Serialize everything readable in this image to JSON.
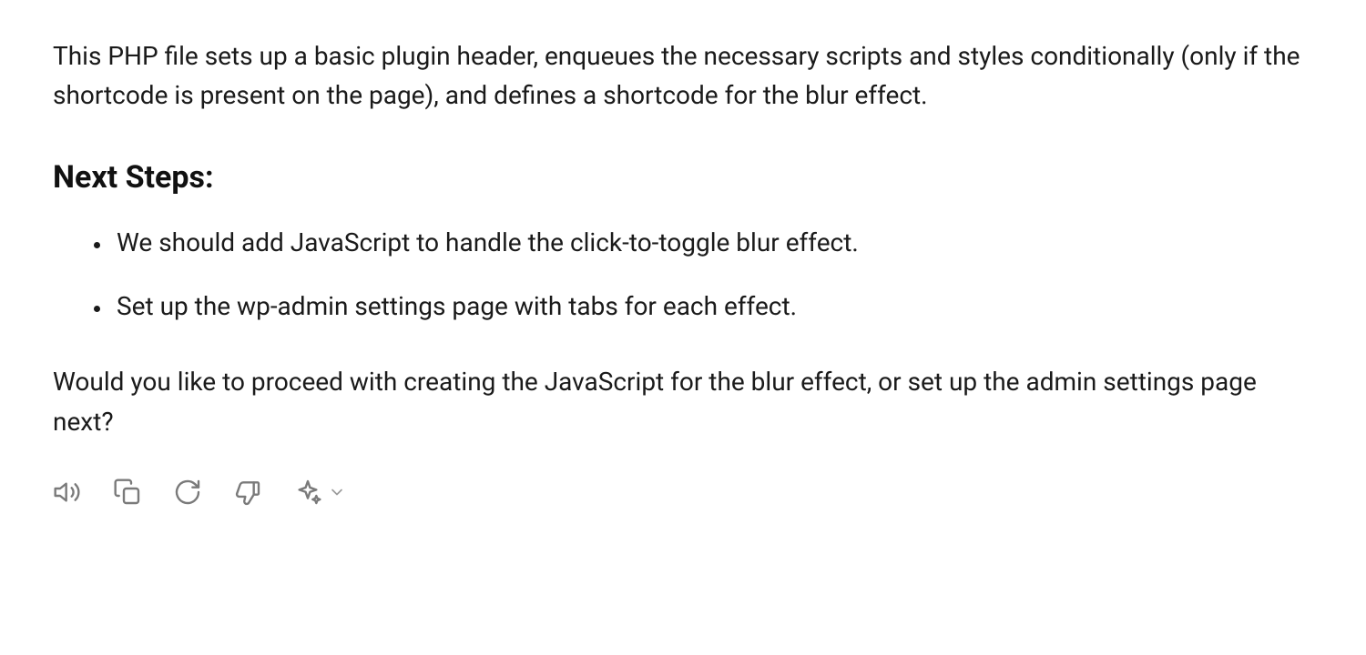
{
  "paragraph1": "This PHP file sets up a basic plugin header, enqueues the necessary scripts and styles conditionally (only if the shortcode is present on the page), and defines a shortcode for the blur effect.",
  "heading": "Next Steps:",
  "list": {
    "item1": "We should add JavaScript to handle the click-to-toggle blur effect.",
    "item2": "Set up the wp-admin settings page with tabs for each effect."
  },
  "paragraph2": "Would you like to proceed with creating the JavaScript for the blur effect, or set up the admin settings page next?"
}
